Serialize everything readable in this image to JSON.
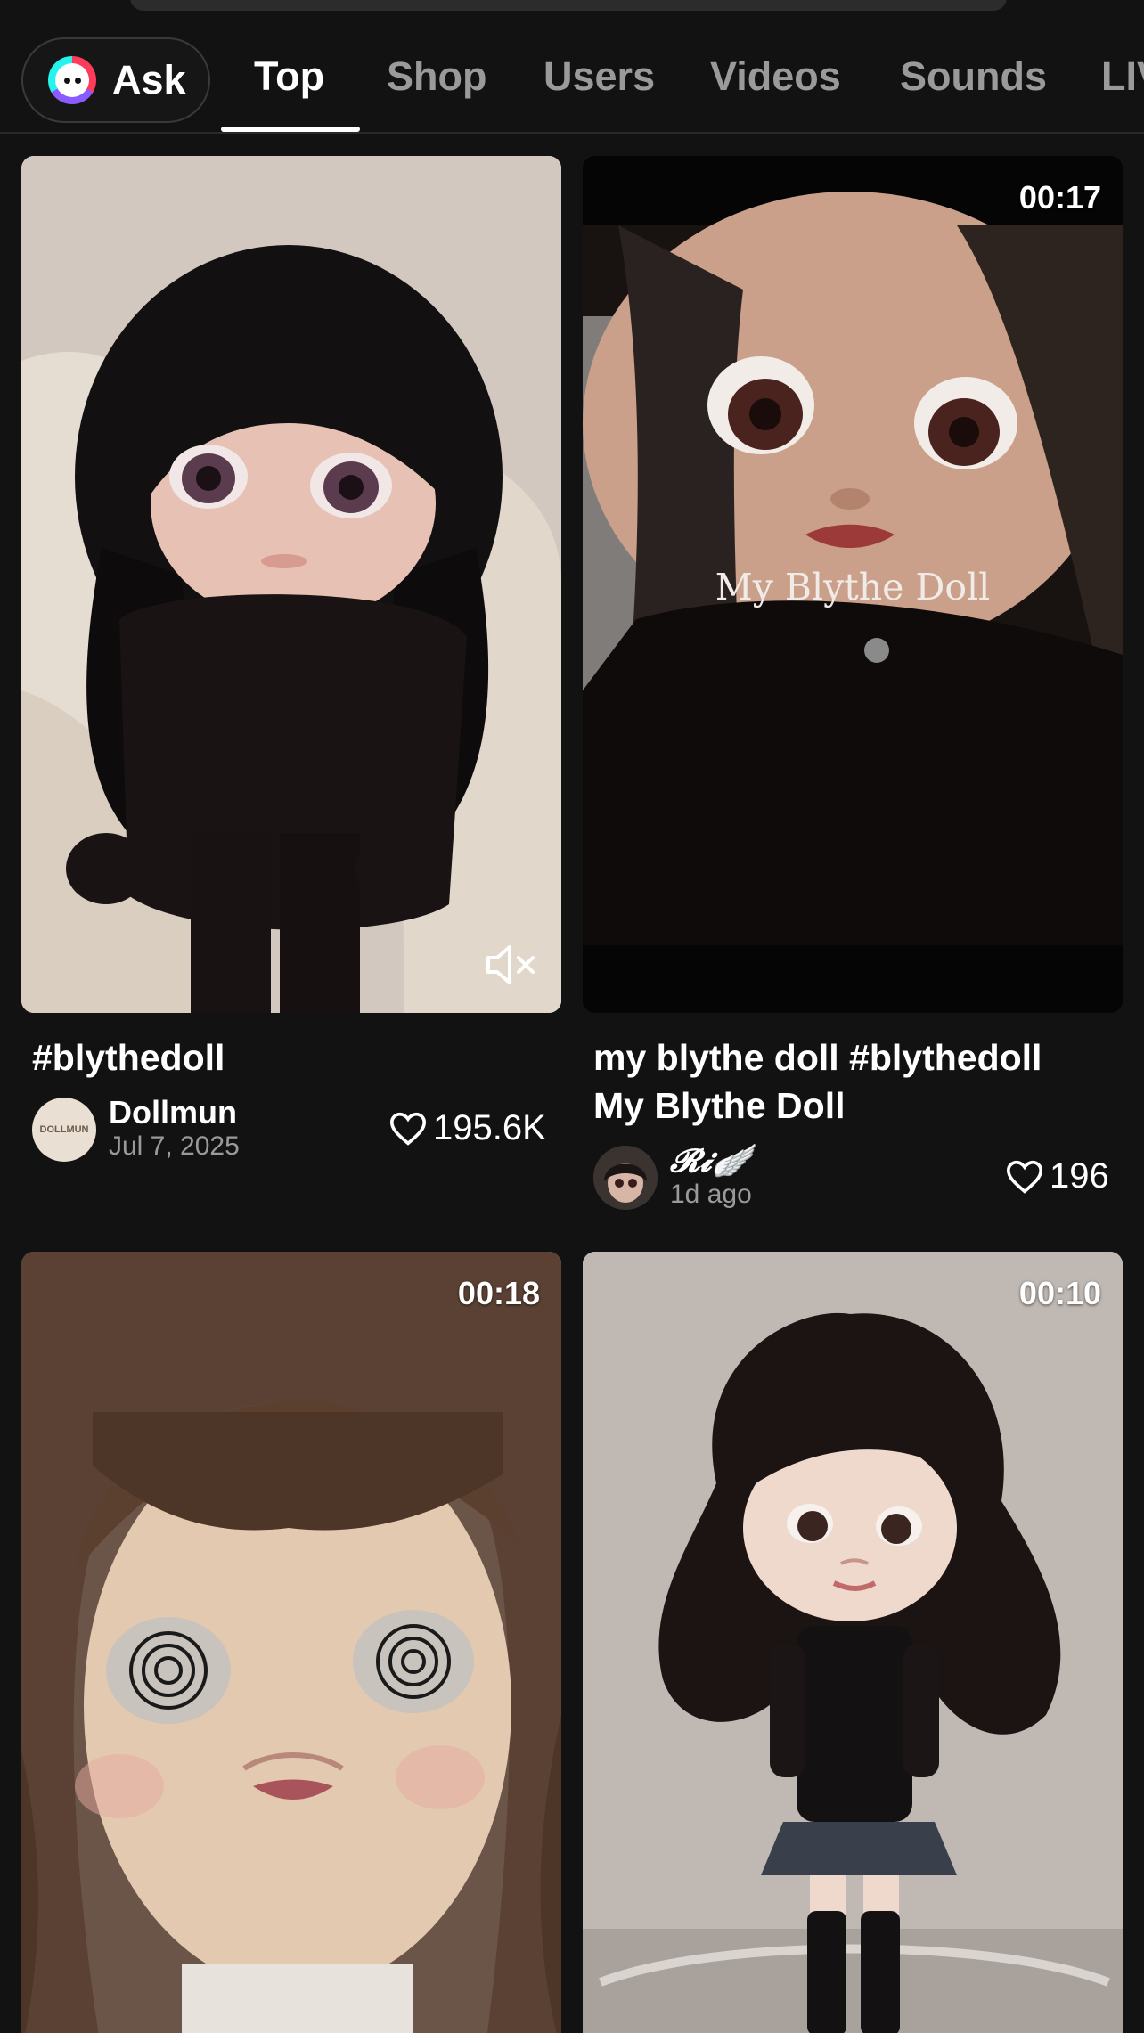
{
  "tabs": {
    "ask_label": "Ask",
    "items": [
      "Top",
      "Shop",
      "Users",
      "Videos",
      "Sounds",
      "LIV"
    ],
    "active": "Top"
  },
  "results": [
    {
      "duration": "",
      "caption_line1": "#blythedoll",
      "caption_line2": "",
      "author": "Dollmun",
      "avatar_text": "DOLLMUN",
      "date": "Jul 7, 2025",
      "likes": "195.6K",
      "muted_icon": "speaker-muted-icon"
    },
    {
      "duration": "00:17",
      "overlay_text": "My Blythe Doll",
      "caption_line1": "my blythe doll #blythedoll",
      "caption_line2": "My Blythe Doll",
      "author": "𝓡𝓲🪽",
      "date": "1d ago",
      "likes": "196"
    },
    {
      "duration": "00:18"
    },
    {
      "duration": "00:10"
    }
  ],
  "colors": {
    "background": "#121212",
    "text_primary": "#ffffff",
    "text_secondary": "#9a9a9a",
    "tab_inactive": "#9a9a9a"
  },
  "icons": [
    "ask-logo-icon",
    "speaker-muted-icon",
    "heart-icon"
  ]
}
